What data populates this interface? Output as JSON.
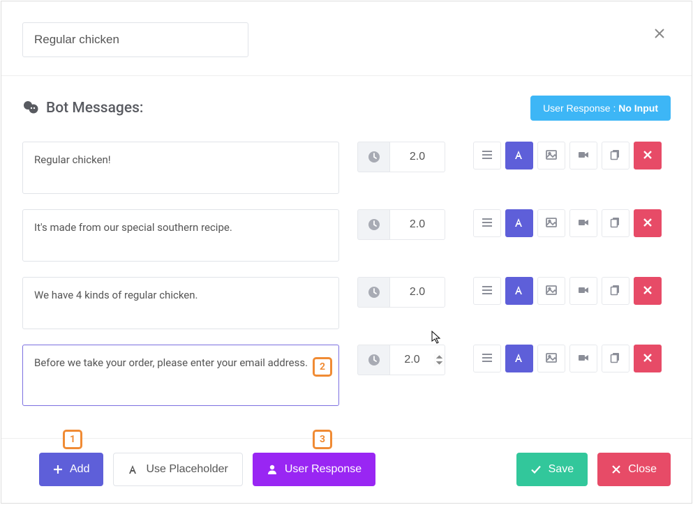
{
  "title": "Regular chicken",
  "section_title": "Bot Messages:",
  "user_response_badge": {
    "label": "User Response :",
    "value": "No Input"
  },
  "messages": [
    {
      "text": "Regular chicken!",
      "delay": "2.0",
      "active": false
    },
    {
      "text": "It's made from our special southern recipe.",
      "delay": "2.0",
      "active": false
    },
    {
      "text": "We have 4 kinds of regular chicken.",
      "delay": "2.0",
      "active": false
    },
    {
      "text": "Before we take your order, please enter your email address.",
      "delay": "2.0",
      "active": true
    }
  ],
  "step_markers": {
    "one": "1",
    "two": "2",
    "three": "3"
  },
  "footer": {
    "add": "Add",
    "placeholder": "Use Placeholder",
    "user_response": "User Response",
    "save": "Save",
    "close": "Close"
  }
}
